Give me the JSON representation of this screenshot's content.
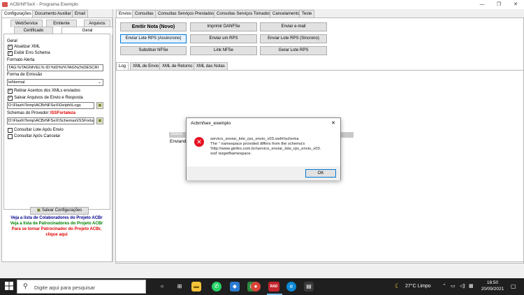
{
  "window": {
    "title": "ACBrNFSeX - Programa Exemplo",
    "minimize": "—",
    "maximize": "❐",
    "close": "✕"
  },
  "left": {
    "top_tabs": [
      "Configurações",
      "Documento Auxiliar",
      "Email"
    ],
    "sub_tabs_row1": [
      "WebService",
      "Emitente",
      "Arquivos"
    ],
    "sub_tabs_row2": [
      "Certificado",
      "Geral"
    ],
    "section_title": "Geral",
    "checkbox_atualizar_xml": "Atualizar XML",
    "checkbox_exibir_erro": "Exibir Erro Schema",
    "formato_alerta_label": "Formato Alerta",
    "formato_alerta_value": "TAG:%TAGNIVEL% ID:%ID%/%TAG%(%DESCRI",
    "forma_emissao_label": "Forma de Emissão",
    "forma_emissao_value": "teNormal",
    "checkbox_retirar_acentos": "Retirar Acentos dos XMLs enviados",
    "checkbox_salvar_arquivos": "Salvar Arquivos de Envio e Resposta",
    "logs_path": "D:\\Flash\\Temp\\ACBrNFSeX\\Delphi\\Logs",
    "schemas_label": "Schemas do Provedor:",
    "schemas_provider": "ISSFortaleza",
    "schemas_path": "D:\\Flash\\Temp\\ACBrNFSeX\\Schemas\\ISSFortale",
    "checkbox_consultar_lote": "Consultar Lote Após Envio",
    "checkbox_consultar_cancelar": "Consultar Após Cancelar",
    "save_button": "Salvar Configurações",
    "link_colaboradores": "Veja a lista de Colaboradores do Projeto ACBr",
    "link_patrocinadores": "Veja a lista de Patrocinadores do Projeto ACBr",
    "link_patrocinar_1": "Para se tornar Patrocinador do Projeto ACBr,",
    "link_patrocinar_2": "clique aqui"
  },
  "right": {
    "top_tabs": [
      "Envios",
      "Consultas",
      "Consultas Serviços Prestados",
      "Consultas Serviços Tomados",
      "Cancelamento",
      "Teste"
    ],
    "buttons": {
      "emitir_nota": "Emitir Nota (Novo)",
      "imprimir_danfse": "Imprimir DANFSe",
      "enviar_email": "Enviar e-mail",
      "enviar_lote_assincrono": "Enviar Lote RPS (Assincrono)",
      "enviar_um_rps": "Enviar um RPS",
      "enviar_lote_sincrono": "Enviar Lote RPS (Sincrono)",
      "substituir_nfse": "Substituir NFSe",
      "link_nfse": "Link NFSe",
      "gerar_lote_rps": "Gerar Lote RPS"
    },
    "log_tabs": [
      "Log",
      "XML de Envio",
      "XML de Retorno",
      "XML das Notas"
    ],
    "log_status_fragment": "Status",
    "log_sending_fragment": "Enviand"
  },
  "dialog": {
    "title": "Acbrnfsex_exemplo",
    "close": "✕",
    "message_lines": [
      "servico_enviar_lote_rps_envio_v03.xsd#/schema",
      "The '' namespace provided differs from the schema's",
      "'http://www.ginfes.com.br/servico_enviar_lote_rps_envio_v03.",
      "xsd' targetNamespace."
    ],
    "ok_label": "OK"
  },
  "taskbar": {
    "search_placeholder": "Digite aqui para pesquisar",
    "weather": "27°C  Limpo",
    "time": "18:50",
    "date": "20/09/2021",
    "app_badge": "RAD"
  },
  "colors": {
    "accent": "#0078d7",
    "error": "#e81123",
    "link_blue": "#00008b",
    "link_green": "#008000",
    "link_red": "#e00000"
  }
}
